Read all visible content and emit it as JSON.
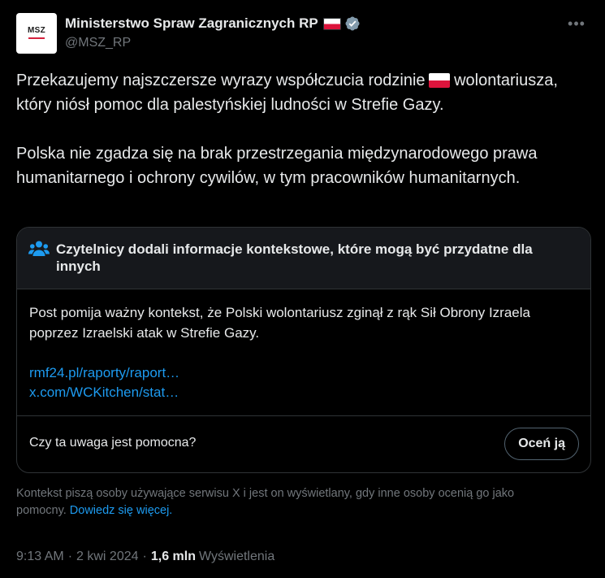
{
  "author": {
    "avatar_text": "MSZ",
    "display_name": "Ministerstwo Spraw Zagranicznych RP",
    "handle": "@MSZ_RP",
    "flag_icon": "poland-flag-icon",
    "verified_icon": "verified-badge-icon",
    "verified_color": "#829aab"
  },
  "more_icon": "more-options-icon",
  "tweet": {
    "paragraph_1_before_flag": "Przekazujemy najszczersze wyrazy współczucia rodzinie",
    "paragraph_1_after_flag": "wolontariusza, który niósł pomoc dla palestyńskiej ludności w Strefie Gazy.",
    "paragraph_2": "Polska nie zgadza się na brak przestrzegania międzynarodowego prawa humanitarnego i ochrony cywilów, w tym pracowników humanitarnych."
  },
  "community_note": {
    "icon": "people-icon",
    "title": "Czytelnicy dodali informacje kontekstowe, które mogą być przydatne dla innych",
    "text": "Post pomija ważny kontekst, że Polski wolontariusz zginął z rąk Sił Obrony Izraela poprzez Izraelski atak w Strefie Gazy.",
    "links": [
      "rmf24.pl/raporty/raport…",
      "x.com/WCKitchen/stat…"
    ],
    "helpful_question": "Czy ta uwaga jest pomocna?",
    "rate_button": "Oceń ją"
  },
  "disclaimer": {
    "text": "Kontekst piszą osoby używające serwisu X i jest on wyświetlany, gdy inne osoby ocenią go jako pomocny.",
    "learn_more": "Dowiedz się więcej."
  },
  "meta": {
    "time": "9:13 AM",
    "date": "2 kwi 2024",
    "views_count": "1,6 mln",
    "views_label": "Wyświetlenia",
    "separator": "·"
  },
  "colors": {
    "background": "#000000",
    "text": "#e7e9ea",
    "secondary_text": "#71767b",
    "link": "#1d9bf0",
    "border": "#2f3336",
    "note_header_bg": "#16181c",
    "flag_red": "#dc143c"
  }
}
